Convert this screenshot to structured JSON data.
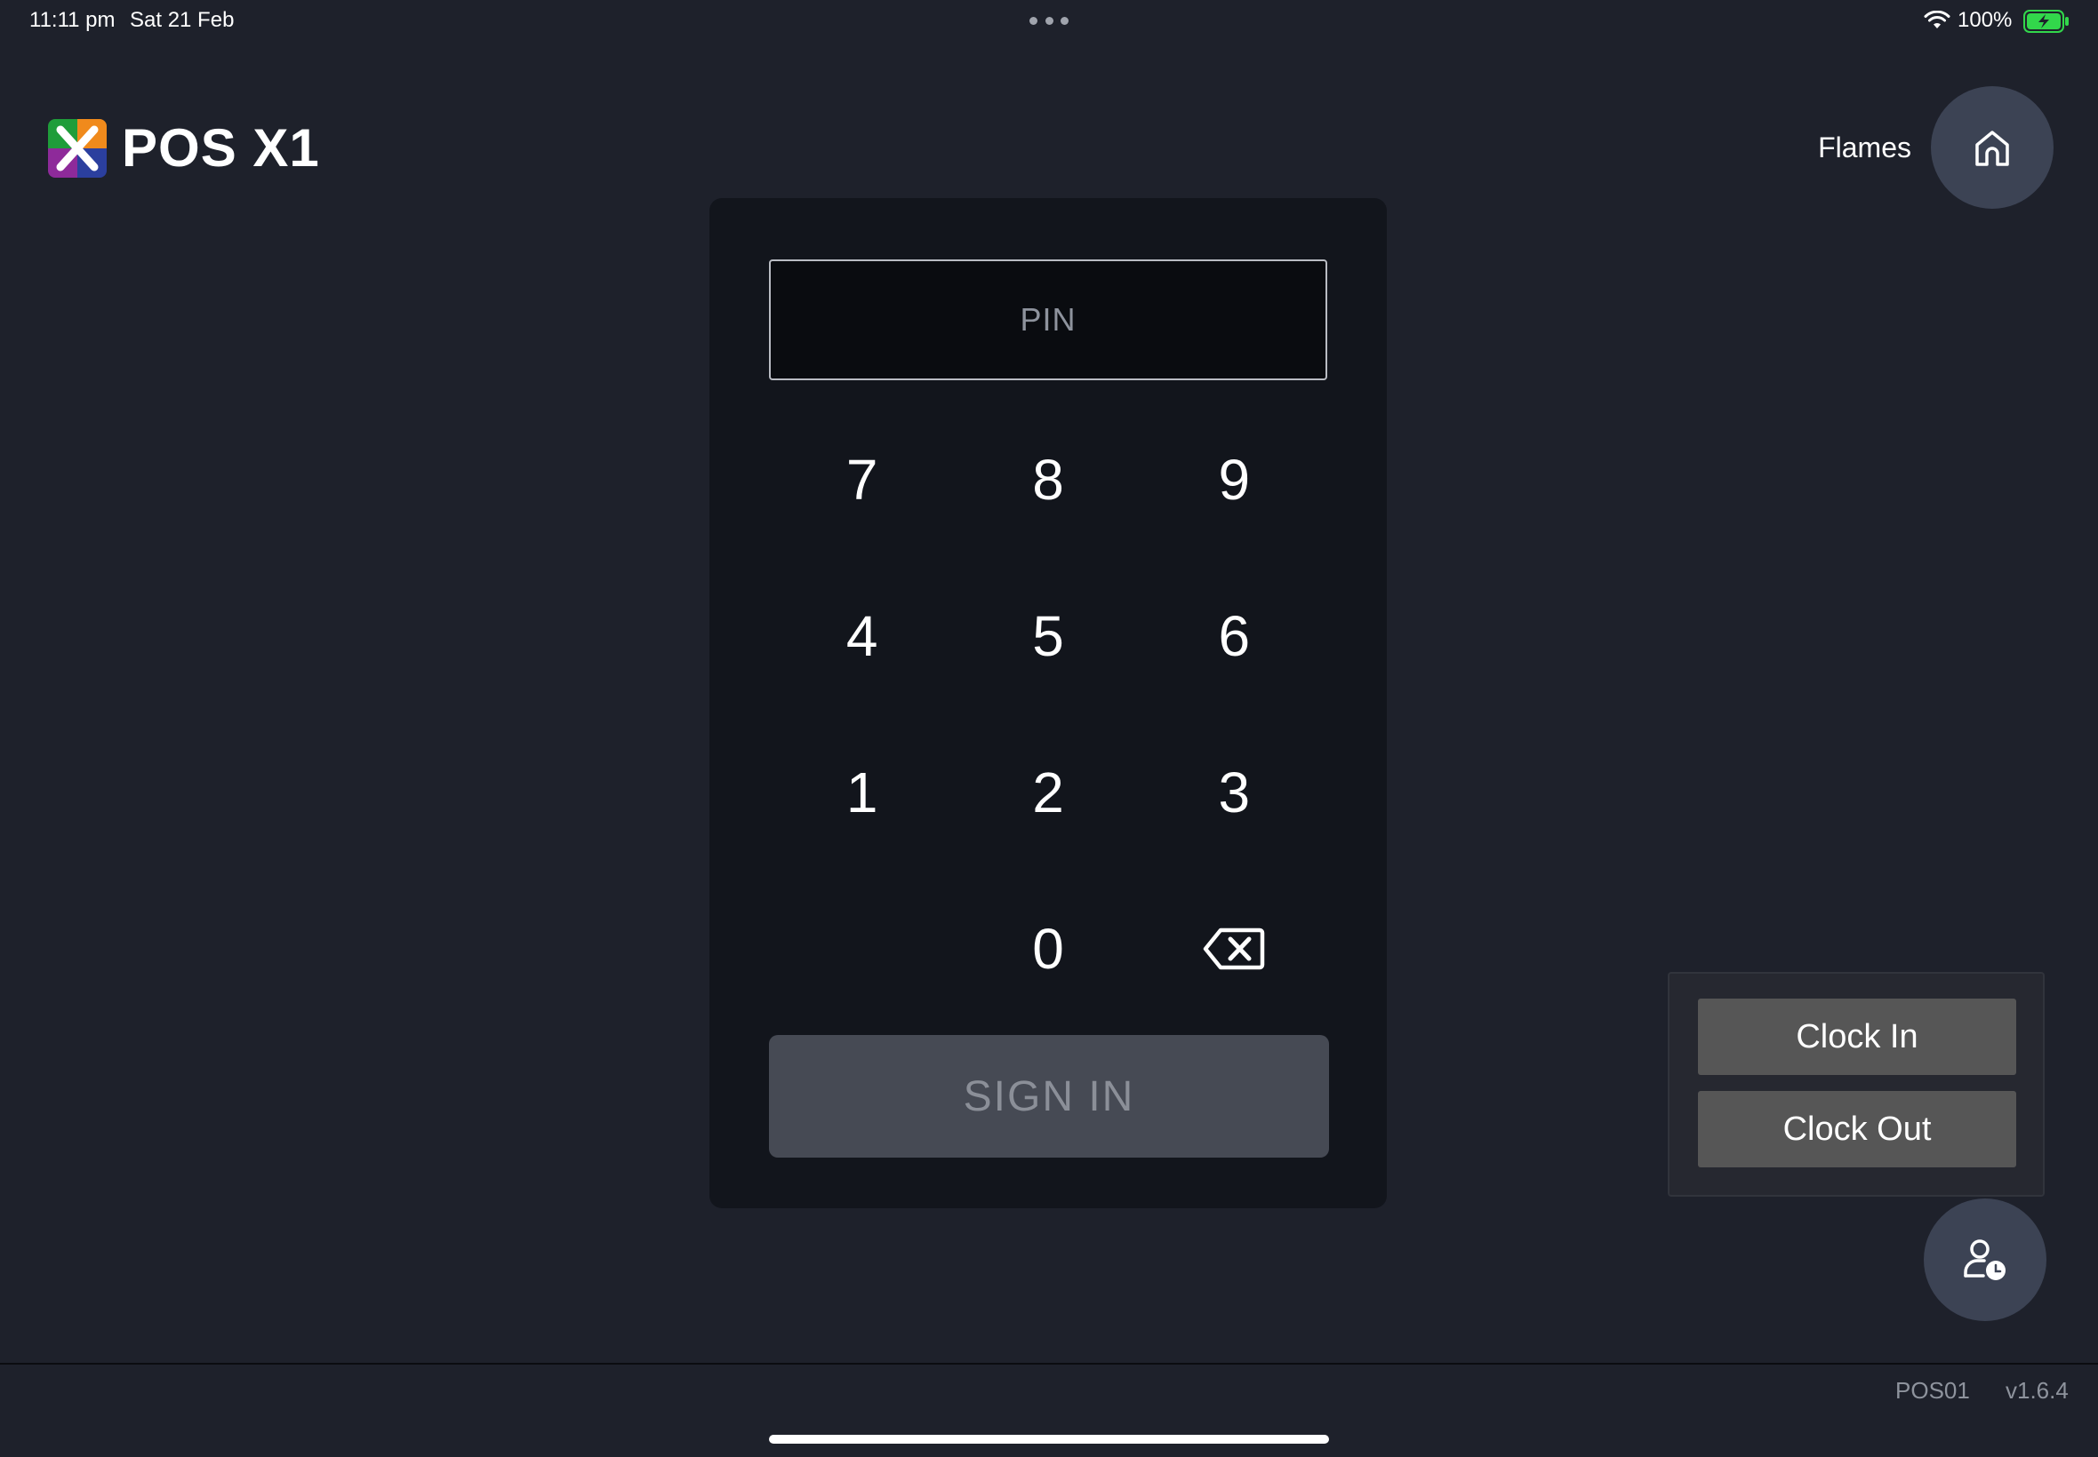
{
  "status_bar": {
    "time": "11:11 pm",
    "date": "Sat 21 Feb",
    "battery_percent": "100%",
    "battery_color": "#32d74b",
    "icons": [
      "multitask-dots-icon",
      "wifi-icon",
      "battery-charging-icon"
    ]
  },
  "header": {
    "app_title": "POS X1",
    "logo_icon": "pos-x1-logo-icon",
    "location_name": "Flames",
    "home_icon": "home-icon"
  },
  "login": {
    "pin_placeholder": "PIN",
    "pin_value": "",
    "keys": [
      "7",
      "8",
      "9",
      "4",
      "5",
      "6",
      "1",
      "2",
      "3",
      "",
      "0",
      "backspace"
    ],
    "backspace_icon": "backspace-icon",
    "sign_in_label": "SIGN IN"
  },
  "clock_panel": {
    "clock_in_label": "Clock In",
    "clock_out_label": "Clock Out",
    "toggle_icon": "user-clock-icon"
  },
  "footer": {
    "terminal_id": "POS01",
    "version": "v1.6.4"
  },
  "colors": {
    "background": "#1e212b",
    "card": "#12151c",
    "accent_circle": "#3c4354",
    "sign_in_bg": "#464a54",
    "clock_button_bg": "#565656"
  }
}
